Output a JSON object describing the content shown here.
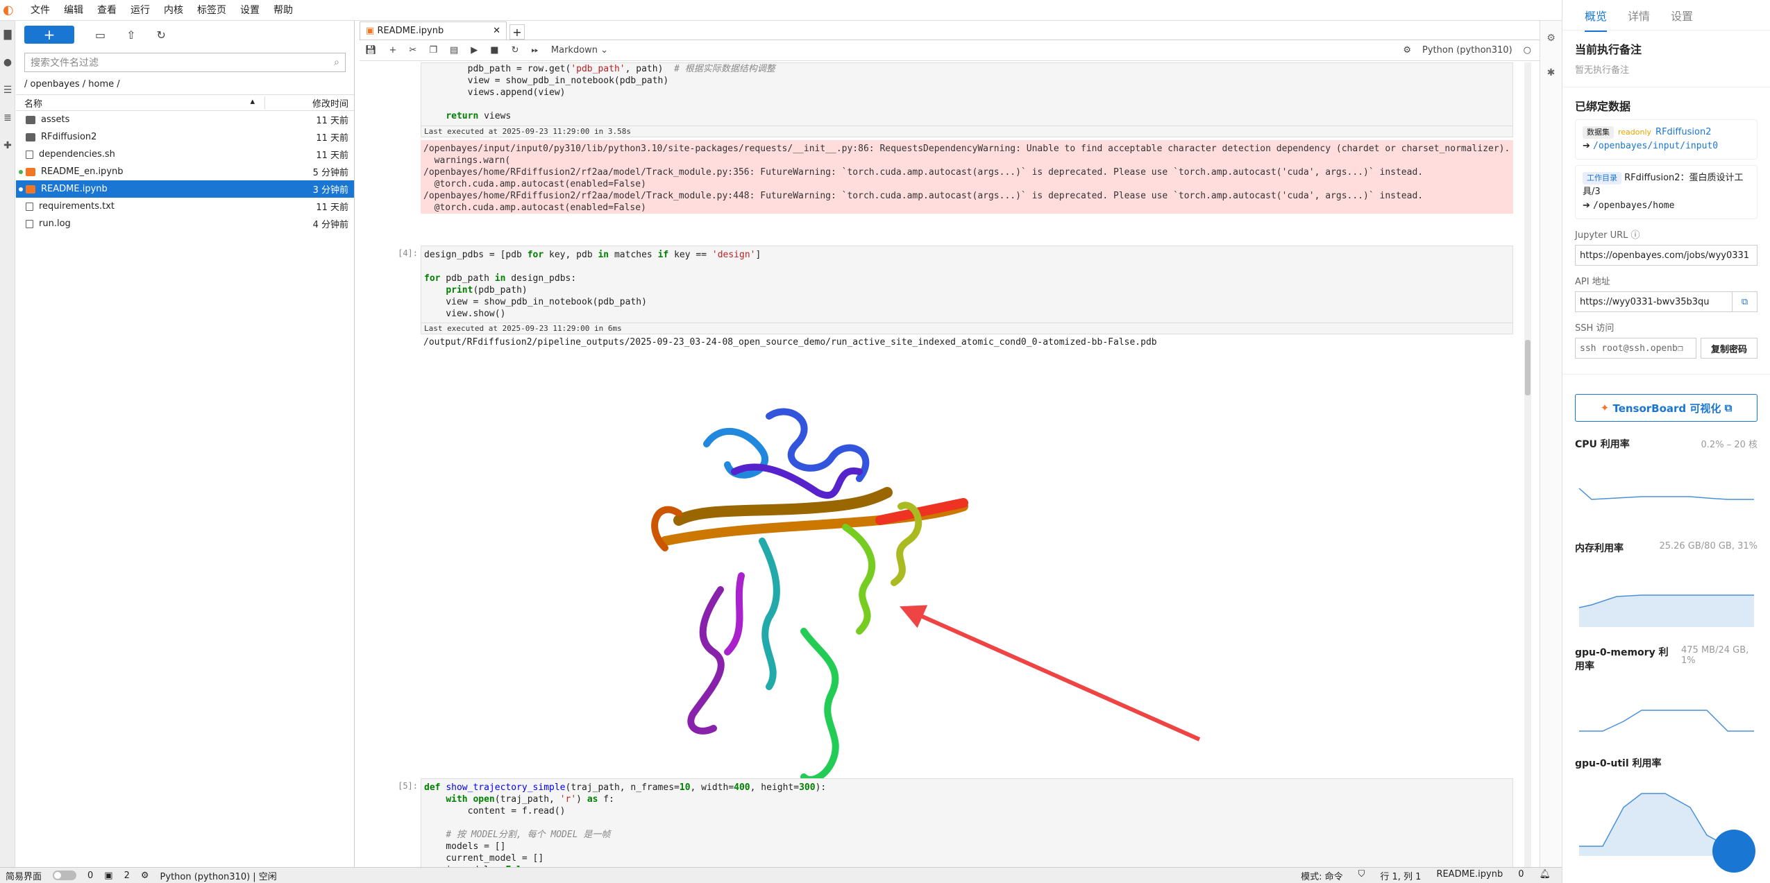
{
  "menu": [
    "文件",
    "编辑",
    "查看",
    "运行",
    "内核",
    "标签页",
    "设置",
    "帮助"
  ],
  "filebrowser": {
    "filter_placeholder": "搜索文件名过滤",
    "breadcrumb": "/ openbayes / home /",
    "col_name": "名称",
    "col_time": "修改时间",
    "files": [
      {
        "name": "assets",
        "time": "11 天前",
        "kind": "folder"
      },
      {
        "name": "RFdiffusion2",
        "time": "11 天前",
        "kind": "folder"
      },
      {
        "name": "dependencies.sh",
        "time": "11 天前",
        "kind": "file"
      },
      {
        "name": "README_en.ipynb",
        "time": "5 分钟前",
        "kind": "notebook"
      },
      {
        "name": "README.ipynb",
        "time": "3 分钟前",
        "kind": "notebook"
      },
      {
        "name": "requirements.txt",
        "time": "11 天前",
        "kind": "file"
      },
      {
        "name": "run.log",
        "time": "4 分钟前",
        "kind": "file"
      }
    ]
  },
  "notebook": {
    "tab": "README.ipynb",
    "celltype": "Markdown",
    "kernel": "Python (python310)",
    "cell3_lastexec": "Last executed at 2025-09-23 11:29:00 in 3.58s",
    "stderr": "/openbayes/input/input0/py310/lib/python3.10/site-packages/requests/__init__.py:86: RequestsDependencyWarning: Unable to find acceptable character detection dependency (chardet or charset_normalizer).\n  warnings.warn(\n/openbayes/home/RFdiffusion2/rf2aa/model/Track_module.py:356: FutureWarning: `torch.cuda.amp.autocast(args...)` is deprecated. Please use `torch.amp.autocast('cuda', args...)` instead.\n  @torch.cuda.amp.autocast(enabled=False)\n/openbayes/home/RFdiffusion2/rf2aa/model/Track_module.py:448: FutureWarning: `torch.cuda.amp.autocast(args...)` is deprecated. Please use `torch.amp.autocast('cuda', args...)` instead.\n  @torch.cuda.amp.autocast(enabled=False)",
    "cell4_prompt": "[4]:",
    "cell4_lastexec": "Last executed at 2025-09-23 11:29:00 in 6ms",
    "cell4_output": "/output/RFdiffusion2/pipeline_outputs/2025-09-23_03-24-08_open_source_demo/run_active_site_indexed_atomic_cond0_0-atomized-bb-False.pdb",
    "cell5_prompt": "[5]:"
  },
  "side": {
    "tabs": [
      "概览",
      "详情",
      "设置"
    ],
    "current_note_title": "当前执行备注",
    "current_note": "暂无执行备注",
    "bound_title": "已绑定数据",
    "dataset_tag": "数据集",
    "readonly": "readonly",
    "dataset_name": "RFdiffusion2",
    "dataset_path": "/openbayes/input/input0",
    "workdir_tag": "工作目录",
    "workdir_name": "RFdiffusion2：蛋白质设计工具/3",
    "workdir_path": "/openbayes/home",
    "jupyter_label": "Jupyter URL",
    "jupyter_url": "https://openbayes.com/jobs/wyy0331",
    "api_label": "API 地址",
    "api_url": "https://wyy0331-bwv35b3qu",
    "ssh_label": "SSH 访问",
    "ssh_cmd": "ssh root@ssh.openb",
    "copy_pwd": "复制密码",
    "tensorboard": "TensorBoard 可视化",
    "cpu_label": "CPU 利用率",
    "cpu_val": "0.2% – 20 核",
    "mem_label": "内存利用率",
    "mem_val": "25.26 GB/80 GB, 31%",
    "gpumem_label": "gpu-0-memory 利用率",
    "gpumem_val": "475 MB/24 GB, 1%",
    "gpuutil_label": "gpu-0-util 利用率"
  },
  "status": {
    "simple": "简易界面",
    "n0": "0",
    "n2": "2",
    "kernel": "Python (python310) | 空闲",
    "mode": "模式: 命令",
    "pos": "行 1, 列 1",
    "file": "README.ipynb",
    "bell": "0"
  },
  "colors": {
    "accent": "#1976d2",
    "error_bg": "#ffdddd",
    "notebook_icon": "#f37626"
  }
}
